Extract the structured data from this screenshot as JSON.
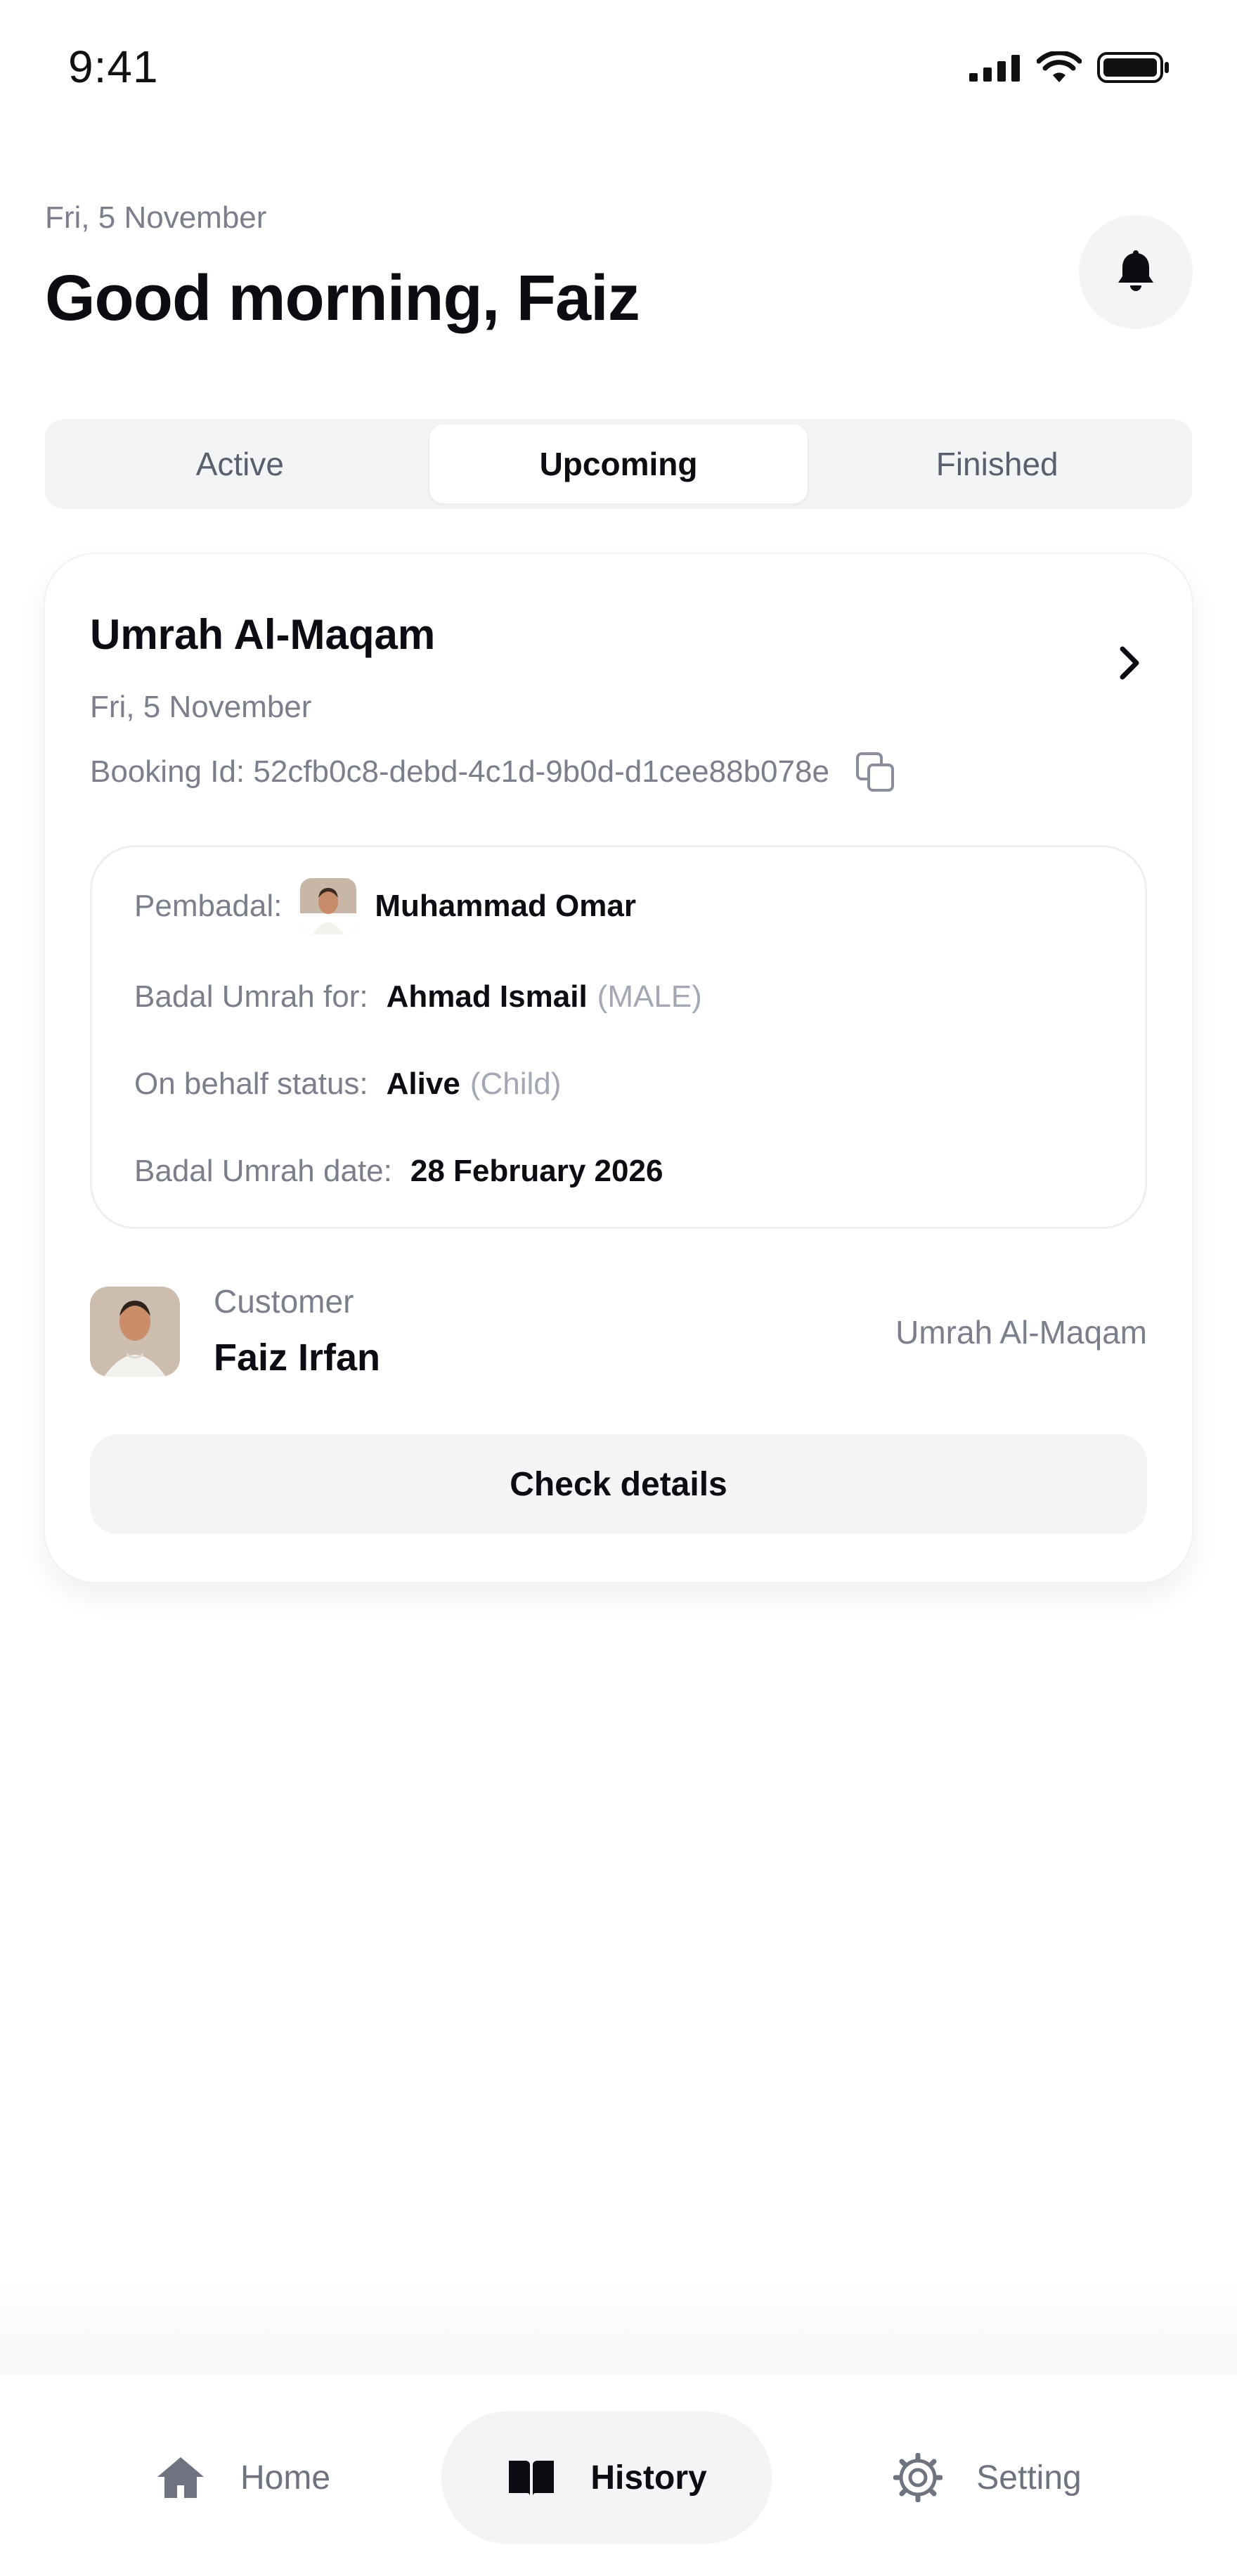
{
  "status_bar": {
    "time": "9:41"
  },
  "header": {
    "date": "Fri, 5 November",
    "greeting": "Good morning, Faiz"
  },
  "tabs": [
    {
      "label": "Active"
    },
    {
      "label": "Upcoming",
      "selected": true
    },
    {
      "label": "Finished"
    }
  ],
  "booking": {
    "title": "Umrah Al-Maqam",
    "date": "Fri, 5 November",
    "booking_id": "Booking Id: 52cfb0c8-debd-4c1d-9b0d-d1cee88b078e",
    "details": {
      "pembadal_label": "Pembadal:",
      "pembadal_name": "Muhammad Omar",
      "for_label": "Badal Umrah for:",
      "for_name": "Ahmad Ismail",
      "for_gender": "(MALE)",
      "status_label": "On behalf status:",
      "status_value": "Alive",
      "status_relation": "(Child)",
      "date_label": "Badal Umrah date:",
      "date_value": "28 February 2026"
    },
    "customer": {
      "label": "Customer",
      "name": "Faiz Irfan",
      "package": "Umrah Al-Maqam"
    },
    "check_button": "Check details"
  },
  "nav": {
    "home": "Home",
    "history": "History",
    "setting": "Setting",
    "active": "history"
  },
  "icons": {
    "bell": "bell-icon",
    "chevron": "chevron-right-icon",
    "copy": "copy-icon",
    "home": "home-icon",
    "history": "book-icon",
    "setting": "gear-icon"
  },
  "colors": {
    "muted_text": "#7b7f8c",
    "surface": "#f3f4f6",
    "primary_text": "#0c0c12"
  }
}
